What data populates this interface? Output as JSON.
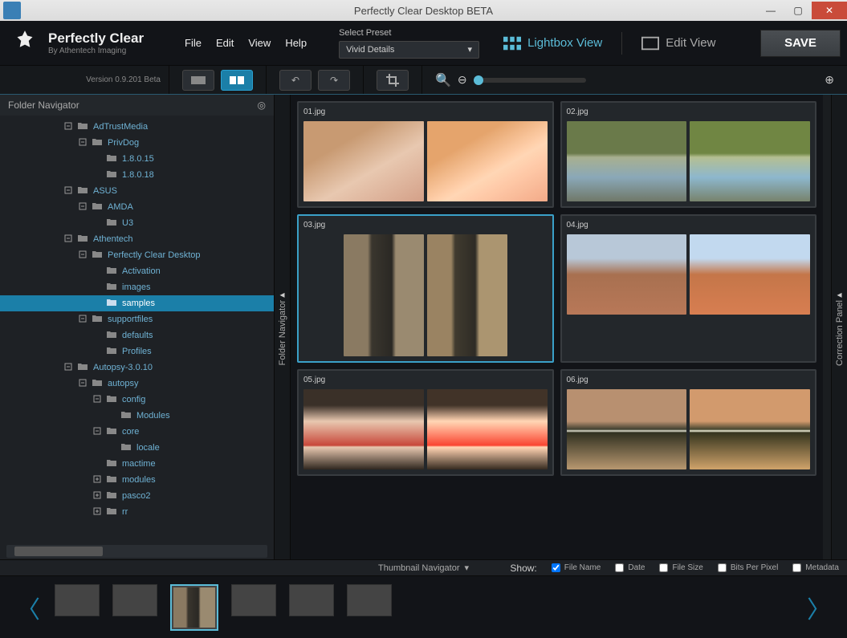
{
  "window": {
    "title": "Perfectly Clear Desktop BETA"
  },
  "branding": {
    "name": "Perfectly Clear",
    "byline": "By Athentech Imaging",
    "version": "Version 0.9.201 Beta"
  },
  "menu": [
    "File",
    "Edit",
    "View",
    "Help"
  ],
  "preset": {
    "label": "Select Preset",
    "value": "Vivid Details"
  },
  "views": {
    "lightbox": "Lightbox View",
    "edit": "Edit View",
    "save": "SAVE"
  },
  "sidebar": {
    "title": "Folder Navigator",
    "vlabel": "Folder Navigator",
    "rightlabel": "Correction Panel",
    "tree": [
      {
        "label": "AdTrustMedia",
        "depth": 0,
        "exp": "minus",
        "icon": "folder-open"
      },
      {
        "label": "PrivDog",
        "depth": 1,
        "exp": "minus",
        "icon": "folder-open"
      },
      {
        "label": "1.8.0.15",
        "depth": 2,
        "exp": "none",
        "icon": "folder"
      },
      {
        "label": "1.8.0.18",
        "depth": 2,
        "exp": "none",
        "icon": "folder"
      },
      {
        "label": "ASUS",
        "depth": 0,
        "exp": "minus",
        "icon": "folder-open"
      },
      {
        "label": "AMDA",
        "depth": 1,
        "exp": "minus",
        "icon": "folder-open"
      },
      {
        "label": "U3",
        "depth": 2,
        "exp": "none",
        "icon": "folder"
      },
      {
        "label": "Athentech",
        "depth": 0,
        "exp": "minus",
        "icon": "folder-open"
      },
      {
        "label": "Perfectly Clear Desktop",
        "depth": 1,
        "exp": "minus",
        "icon": "folder-open"
      },
      {
        "label": "Activation",
        "depth": 2,
        "exp": "none",
        "icon": "folder"
      },
      {
        "label": "images",
        "depth": 2,
        "exp": "none",
        "icon": "folder"
      },
      {
        "label": "samples",
        "depth": 2,
        "exp": "none",
        "icon": "folder",
        "selected": true
      },
      {
        "label": "supportfiles",
        "depth": 1,
        "exp": "minus",
        "icon": "folder-open"
      },
      {
        "label": "defaults",
        "depth": 2,
        "exp": "none",
        "icon": "folder"
      },
      {
        "label": "Profiles",
        "depth": 2,
        "exp": "none",
        "icon": "folder"
      },
      {
        "label": "Autopsy-3.0.10",
        "depth": 0,
        "exp": "minus",
        "icon": "folder-open"
      },
      {
        "label": "autopsy",
        "depth": 1,
        "exp": "minus",
        "icon": "folder-open"
      },
      {
        "label": "config",
        "depth": 2,
        "exp": "minus",
        "icon": "folder-open"
      },
      {
        "label": "Modules",
        "depth": 3,
        "exp": "none",
        "icon": "folder"
      },
      {
        "label": "core",
        "depth": 2,
        "exp": "minus",
        "icon": "folder-open"
      },
      {
        "label": "locale",
        "depth": 3,
        "exp": "none",
        "icon": "folder"
      },
      {
        "label": "mactime",
        "depth": 2,
        "exp": "none",
        "icon": "folder"
      },
      {
        "label": "modules",
        "depth": 2,
        "exp": "plus",
        "icon": "folder"
      },
      {
        "label": "pasco2",
        "depth": 2,
        "exp": "plus",
        "icon": "folder"
      },
      {
        "label": "rr",
        "depth": 2,
        "exp": "plus",
        "icon": "folder"
      }
    ]
  },
  "gallery": {
    "items": [
      {
        "name": "01.jpg",
        "img": "img-baby",
        "aspect": "land"
      },
      {
        "name": "02.jpg",
        "img": "img-river",
        "aspect": "land"
      },
      {
        "name": "03.jpg",
        "img": "img-kid",
        "aspect": "port",
        "selected": true
      },
      {
        "name": "04.jpg",
        "img": "img-city",
        "aspect": "land"
      },
      {
        "name": "05.jpg",
        "img": "img-model",
        "aspect": "land"
      },
      {
        "name": "06.jpg",
        "img": "img-zebra",
        "aspect": "land"
      }
    ]
  },
  "footer": {
    "thumbnail_nav": "Thumbnail Navigator",
    "show_label": "Show:",
    "checks": [
      {
        "label": "File Name",
        "checked": true
      },
      {
        "label": "Date",
        "checked": false
      },
      {
        "label": "File Size",
        "checked": false
      },
      {
        "label": "Bits Per Pixel",
        "checked": false
      },
      {
        "label": "Metadata",
        "checked": false
      }
    ]
  },
  "strip": {
    "thumbs": [
      "img-baby",
      "img-river",
      "img-kid",
      "img-city",
      "img-model",
      "img-zebra"
    ],
    "selected_index": 2
  }
}
